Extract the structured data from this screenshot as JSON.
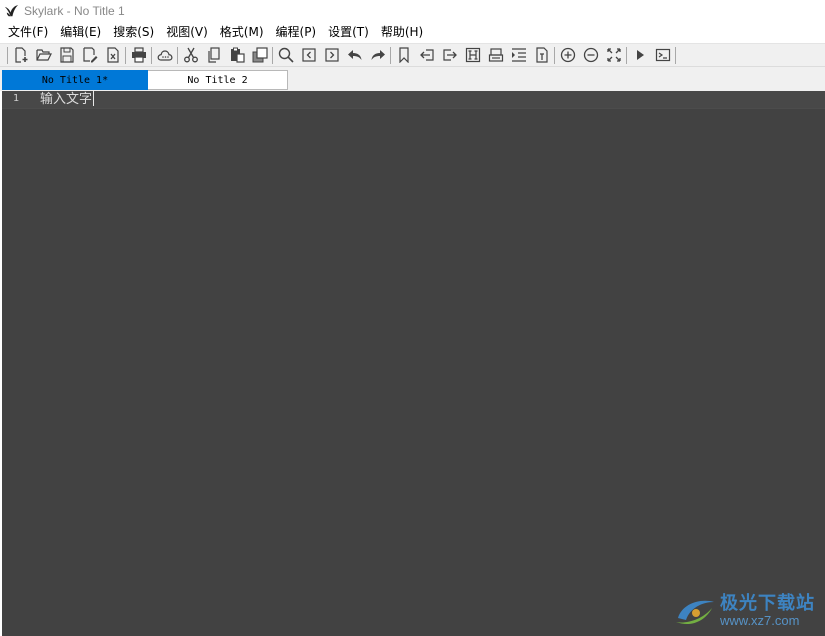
{
  "window": {
    "title": "Skylark - No Title 1"
  },
  "menu": [
    {
      "name": "menu-file",
      "label": "文件(F)"
    },
    {
      "name": "menu-edit",
      "label": "编辑(E)"
    },
    {
      "name": "menu-search",
      "label": "搜索(S)"
    },
    {
      "name": "menu-view",
      "label": "视图(V)"
    },
    {
      "name": "menu-format",
      "label": "格式(M)"
    },
    {
      "name": "menu-program",
      "label": "编程(P)"
    },
    {
      "name": "menu-settings",
      "label": "设置(T)"
    },
    {
      "name": "menu-help",
      "label": "帮助(H)"
    }
  ],
  "toolbar": {
    "groups": [
      [
        "new-file-icon",
        "open-folder-icon",
        "save-icon",
        "save-as-icon",
        "close-file-icon"
      ],
      [
        "print-icon"
      ],
      [
        "cloud-icon"
      ],
      [
        "cut-icon",
        "copy-icon",
        "paste-icon",
        "duplicate-icon"
      ],
      [
        "search-icon",
        "find-prev-icon",
        "find-next-icon",
        "undo-icon",
        "redo-icon"
      ],
      [
        "bookmark-icon",
        "goto-prev-icon",
        "goto-next-icon",
        "hex-view-icon",
        "print-preview-icon",
        "indent-icon",
        "file-info-icon"
      ],
      [
        "zoom-in-icon",
        "zoom-out-icon",
        "fullscreen-icon"
      ],
      [
        "run-icon",
        "console-icon"
      ]
    ]
  },
  "tabs": [
    {
      "label": "No Title 1*",
      "active": true
    },
    {
      "label": "No Title 2",
      "active": false
    }
  ],
  "editor": {
    "lines": [
      {
        "number": "1",
        "text": "输入文字"
      }
    ]
  },
  "watermark": {
    "name": "极光下载站",
    "url": "www.xz7.com"
  },
  "colors": {
    "active_tab": "#0078d7",
    "editor_bg": "#424242",
    "toolbar_bg": "#f0f0f0"
  }
}
